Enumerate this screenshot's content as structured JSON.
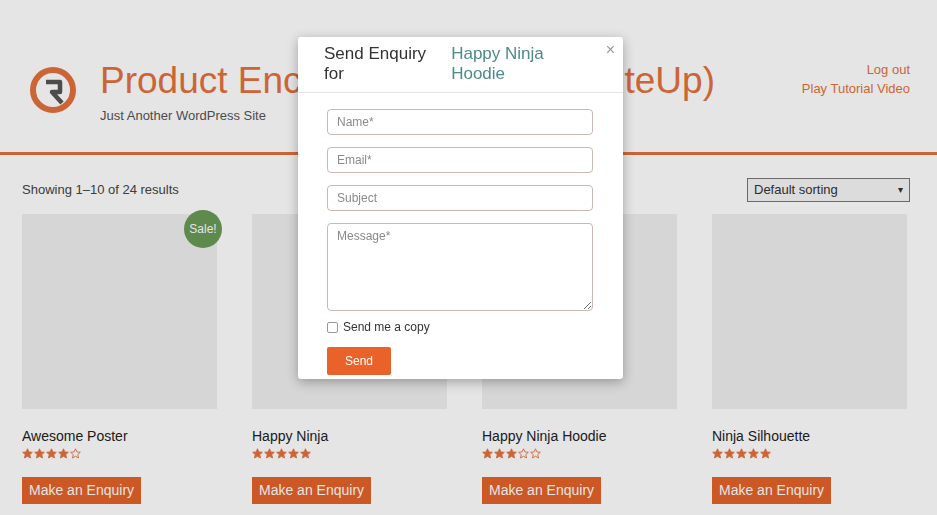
{
  "header": {
    "links": [
      "Log out",
      "Play Tutorial Video"
    ],
    "title_left": "Product Enc",
    "title_right": "teUp)",
    "tagline": "Just Another WordPress Site"
  },
  "shop": {
    "result_count": "Showing 1–10 of 24 results",
    "sorting": {
      "value": "Default sorting",
      "caret": "▾"
    },
    "products": [
      {
        "name": "Awesome Poster",
        "stars": 4,
        "badge": "Sale!",
        "button": "Make an Enquiry"
      },
      {
        "name": "Happy Ninja",
        "stars": 5,
        "button": "Make an Enquiry"
      },
      {
        "name": "Happy Ninja Hoodie",
        "stars": 3,
        "button": "Make an Enquiry"
      },
      {
        "name": "Ninja Silhouette",
        "stars": 5,
        "button": "Make an Enquiry"
      }
    ]
  },
  "modal": {
    "title_prefix": "Send Enquiry for",
    "product": "Happy Ninja Hoodie",
    "close": "×",
    "fields": [
      {
        "kind": "input",
        "placeholder": "Name*"
      },
      {
        "kind": "input",
        "placeholder": "Email*"
      },
      {
        "kind": "input",
        "placeholder": "Subject"
      },
      {
        "kind": "textarea",
        "placeholder": "Message*"
      }
    ],
    "copy": {
      "label": "Send me a copy",
      "checked": false
    },
    "submit": "Send"
  }
}
